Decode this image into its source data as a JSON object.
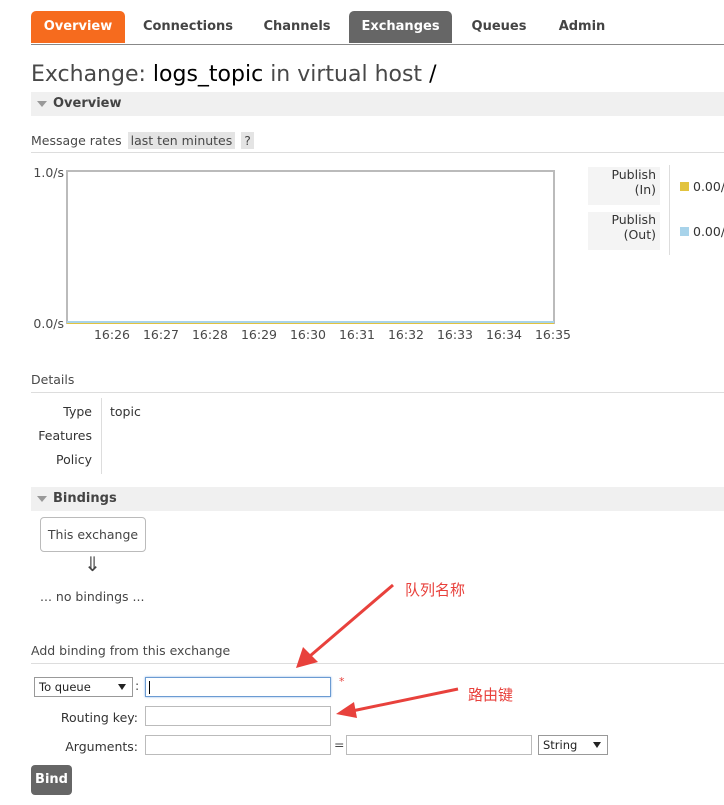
{
  "nav": {
    "tabs": [
      {
        "label": "Overview"
      },
      {
        "label": "Connections"
      },
      {
        "label": "Channels"
      },
      {
        "label": "Exchanges"
      },
      {
        "label": "Queues"
      },
      {
        "label": "Admin"
      }
    ]
  },
  "title": {
    "prefix": "Exchange:",
    "exchange_name": "logs_topic",
    "middle": "in virtual host",
    "vhost": "/"
  },
  "overview": {
    "header": "Overview",
    "message_rates_label": "Message rates",
    "range_badge": "last ten minutes",
    "help_badge": "?"
  },
  "chart_data": {
    "type": "line",
    "y_ticks": [
      "1.0/s",
      "0.0/s"
    ],
    "ylim": [
      0,
      1
    ],
    "x": [
      "16:26",
      "16:27",
      "16:28",
      "16:29",
      "16:30",
      "16:31",
      "16:32",
      "16:33",
      "16:34",
      "16:35"
    ],
    "series": [
      {
        "name": "Publish (In)",
        "values": [
          0,
          0,
          0,
          0,
          0,
          0,
          0,
          0,
          0,
          0
        ],
        "color": "#e2c33e"
      },
      {
        "name": "Publish (Out)",
        "values": [
          0,
          0,
          0,
          0,
          0,
          0,
          0,
          0,
          0,
          0
        ],
        "color": "#a8d3ea"
      }
    ]
  },
  "legend": {
    "items": [
      {
        "line1": "Publish",
        "line2": "(In)",
        "value": "0.00/",
        "color": "#e2c33e"
      },
      {
        "line1": "Publish",
        "line2": "(Out)",
        "value": "0.00/",
        "color": "#a8d3ea"
      }
    ]
  },
  "details": {
    "header": "Details",
    "rows": [
      {
        "label": "Type",
        "value": "topic"
      },
      {
        "label": "Features",
        "value": ""
      },
      {
        "label": "Policy",
        "value": ""
      }
    ]
  },
  "bindings": {
    "header": "Bindings",
    "this_exchange": "This exchange",
    "arrow": "⇓",
    "empty_text": "... no bindings ..."
  },
  "add_binding": {
    "header": "Add binding from this exchange",
    "destination_select": "To queue",
    "colon": ":",
    "required_mark": "*",
    "routing_key_label": "Routing key:",
    "arguments_label": "Arguments:",
    "equals": "=",
    "type_select": "String",
    "bind_button": "Bind"
  },
  "annotations": {
    "queue_name": "队列名称",
    "routing_key": "路由键"
  }
}
